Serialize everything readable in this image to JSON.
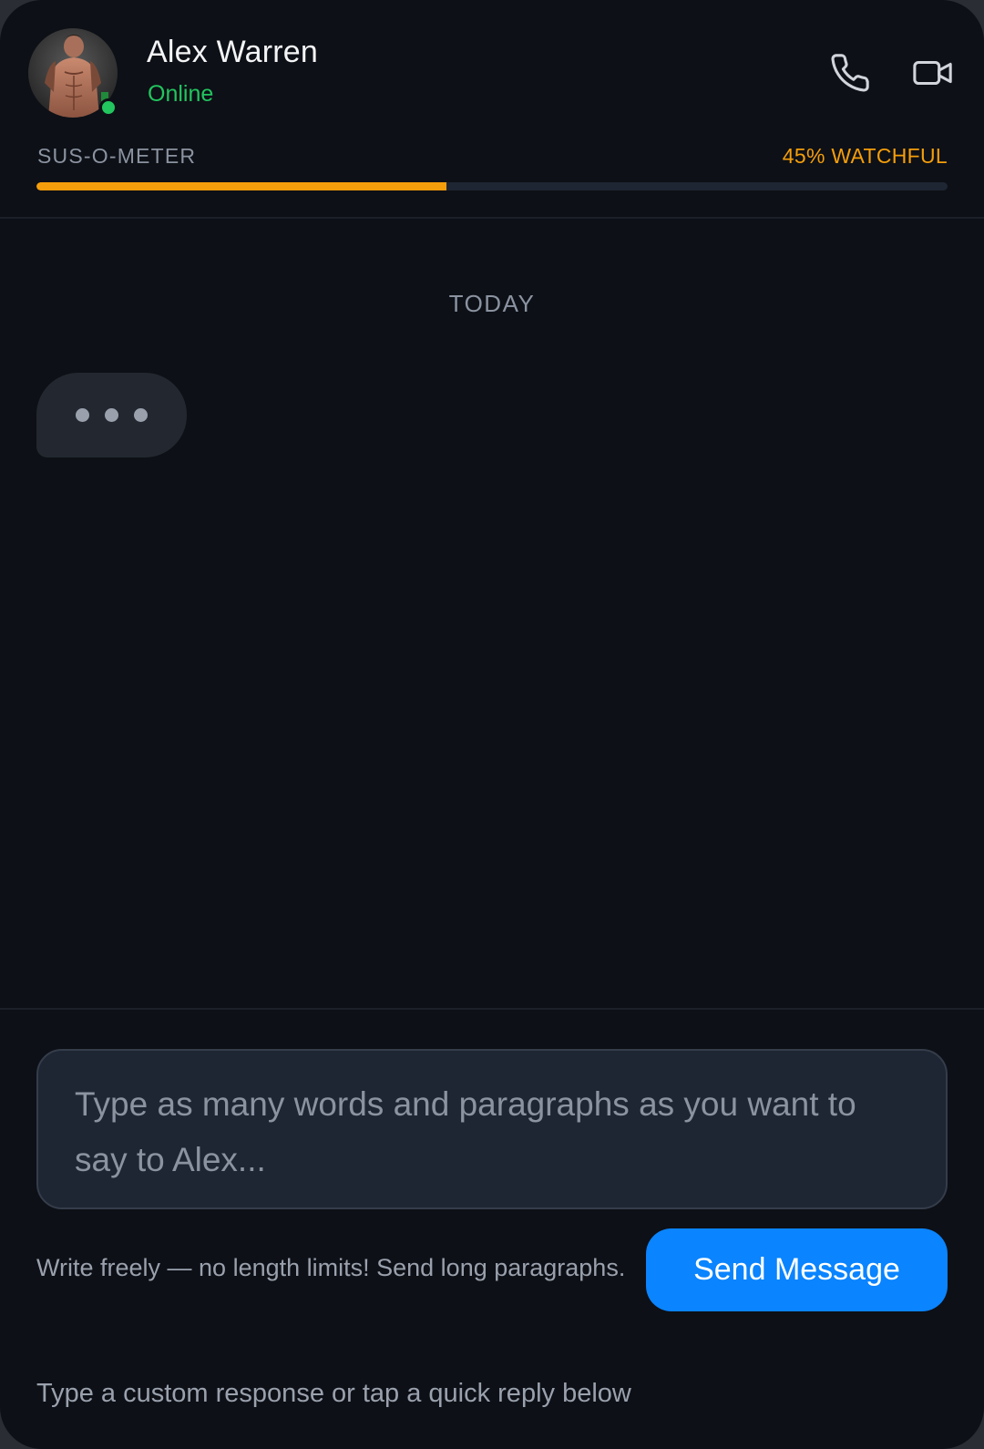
{
  "contact": {
    "name": "Alex Warren",
    "status": "Online",
    "avatar_icon": "profile-photo",
    "presence_color": "#22c55e"
  },
  "header_actions": {
    "call_icon": "phone-icon",
    "video_icon": "video-camera-icon"
  },
  "meter": {
    "label": "SUS-O-METER",
    "value_text": "45% WATCHFUL",
    "percent": 45,
    "color": "#f59e0b"
  },
  "conversation": {
    "day_label": "TODAY",
    "typing_indicator": true
  },
  "composer": {
    "value": "",
    "placeholder": "Type as many words and paragraphs as you want to say to Alex..."
  },
  "hint": "Write freely — no length limits! Send long paragraphs.",
  "send_button": {
    "label": "Send Message",
    "color": "#0a84ff"
  },
  "footer_hint": "Type a custom response or tap a quick reply below"
}
